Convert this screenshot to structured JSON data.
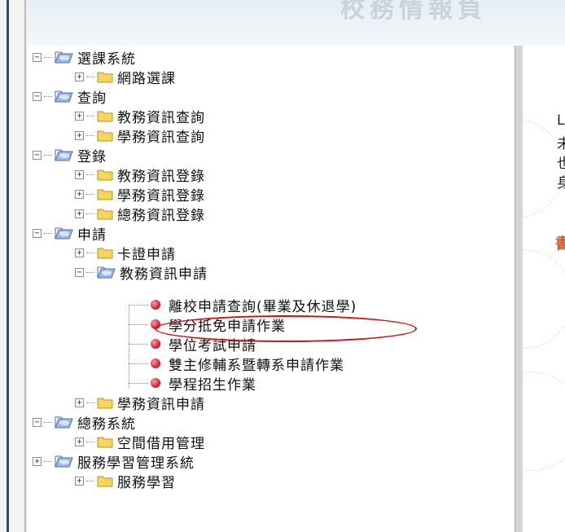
{
  "banner": {
    "title": "校務情報負"
  },
  "tree": {
    "groups": [
      {
        "label": "選課系統",
        "expander": "−",
        "children": [
          {
            "label": "網路選課",
            "expander": "+"
          }
        ]
      },
      {
        "label": "查詢",
        "expander": "−",
        "children": [
          {
            "label": "教務資訊查詢",
            "expander": "+"
          },
          {
            "label": "學務資訊查詢",
            "expander": "+"
          }
        ]
      },
      {
        "label": "登錄",
        "expander": "−",
        "children": [
          {
            "label": "教務資訊登錄",
            "expander": "+"
          },
          {
            "label": "學務資訊登錄",
            "expander": "+"
          },
          {
            "label": "總務資訊登錄",
            "expander": "+"
          }
        ]
      },
      {
        "label": "申請",
        "expander": "−",
        "children": [
          {
            "label": "卡證申請",
            "expander": "+"
          },
          {
            "label": "教務資訊申請",
            "expander": "−",
            "items": [
              "離校申請查詢(畢業及休退學)",
              "學分抵免申請作業",
              "學位考試申請",
              "雙主修輔系暨轉系申請作業",
              "學程招生作業"
            ]
          },
          {
            "label": "學務資訊申請",
            "expander": "+"
          }
        ]
      },
      {
        "label": "總務系統",
        "expander": "−",
        "children": [
          {
            "label": "空間借用管理",
            "expander": "+"
          }
        ]
      },
      {
        "label": "服務學習管理系統",
        "expander": "+",
        "children": [
          {
            "label": "服務學習",
            "expander": "+"
          }
        ]
      }
    ],
    "highlighted_item": "學分抵免申請作業"
  },
  "right_panel": {
    "lines": [
      "L",
      "未",
      "也",
      "身"
    ],
    "red_text": "書"
  },
  "colors": {
    "highlight_circle": "#d0101a",
    "bullet": "#d0102a",
    "folder": "#f5d65a"
  }
}
